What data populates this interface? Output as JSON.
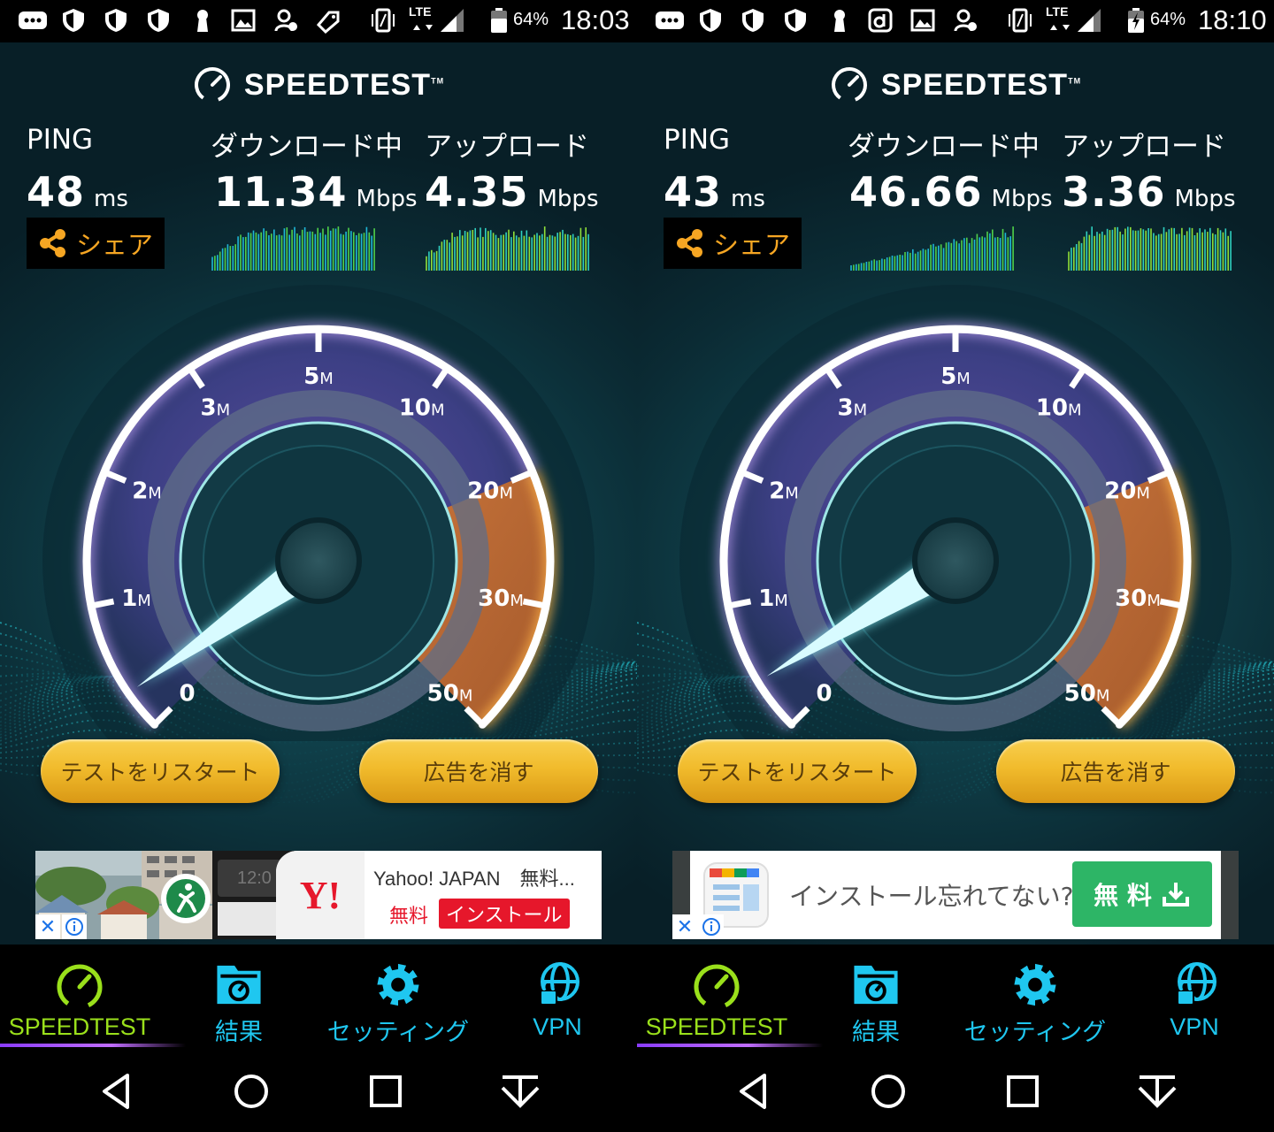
{
  "colors": {
    "accent_cyan": "#1fc7f0",
    "accent_green": "#9ae01b",
    "share_orange": "#f6a623",
    "button_gold": "#f1bb2c",
    "yahoo_red": "#e6172b"
  },
  "screens": [
    {
      "status": {
        "network": "LTE",
        "battery": "64%",
        "time": "18:03"
      },
      "brand": "SPEEDTEST",
      "ping": {
        "label": "PING",
        "value": "48",
        "unit": "ms"
      },
      "download": {
        "label": "ダウンロード中",
        "value": "11.34",
        "unit": "Mbps"
      },
      "upload": {
        "label": "アップロード",
        "value": "4.35",
        "unit": "Mbps"
      },
      "share_label": "シェア",
      "gauge": {
        "ticks": [
          {
            "num": "0",
            "suffix": ""
          },
          {
            "num": "1",
            "suffix": "M"
          },
          {
            "num": "2",
            "suffix": "M"
          },
          {
            "num": "3",
            "suffix": "M"
          },
          {
            "num": "5",
            "suffix": "M"
          },
          {
            "num": "10",
            "suffix": "M"
          },
          {
            "num": "20",
            "suffix": "M"
          },
          {
            "num": "30",
            "suffix": "M"
          },
          {
            "num": "50",
            "suffix": "M"
          }
        ],
        "needle_mbps": 0.3
      },
      "buttons": {
        "restart": "テストをリスタート",
        "remove_ads": "広告を消す"
      },
      "ad": {
        "type": "yahoo",
        "clock": "12:0",
        "title": "Yahoo! JAPAN　無料...",
        "free": "無料",
        "install": "インストール",
        "logo": "Y!"
      },
      "nav": [
        {
          "label": "SPEEDTEST",
          "icon": "speedometer-icon",
          "active": true
        },
        {
          "label": "結果",
          "icon": "results-icon",
          "active": false
        },
        {
          "label": "セッティング",
          "icon": "gear-icon",
          "active": false
        },
        {
          "label": "VPN",
          "icon": "vpn-globe-lock-icon",
          "active": false
        }
      ]
    },
    {
      "status": {
        "network": "LTE",
        "battery": "64%",
        "time": "18:10"
      },
      "brand": "SPEEDTEST",
      "ping": {
        "label": "PING",
        "value": "43",
        "unit": "ms"
      },
      "download": {
        "label": "ダウンロード中",
        "value": "46.66",
        "unit": "Mbps"
      },
      "upload": {
        "label": "アップロード",
        "value": "3.36",
        "unit": "Mbps"
      },
      "share_label": "シェア",
      "gauge": {
        "ticks": [
          {
            "num": "0",
            "suffix": ""
          },
          {
            "num": "1",
            "suffix": "M"
          },
          {
            "num": "2",
            "suffix": "M"
          },
          {
            "num": "3",
            "suffix": "M"
          },
          {
            "num": "5",
            "suffix": "M"
          },
          {
            "num": "10",
            "suffix": "M"
          },
          {
            "num": "20",
            "suffix": "M"
          },
          {
            "num": "30",
            "suffix": "M"
          },
          {
            "num": "50",
            "suffix": "M"
          }
        ],
        "needle_mbps": 0.4
      },
      "buttons": {
        "restart": "テストをリスタート",
        "remove_ads": "広告を消す"
      },
      "ad": {
        "type": "install",
        "headline": "インストール忘れてない?",
        "cta": "無 料"
      },
      "nav": [
        {
          "label": "SPEEDTEST",
          "icon": "speedometer-icon",
          "active": true
        },
        {
          "label": "結果",
          "icon": "results-icon",
          "active": false
        },
        {
          "label": "セッティング",
          "icon": "gear-icon",
          "active": false
        },
        {
          "label": "VPN",
          "icon": "vpn-globe-lock-icon",
          "active": false
        }
      ]
    }
  ]
}
